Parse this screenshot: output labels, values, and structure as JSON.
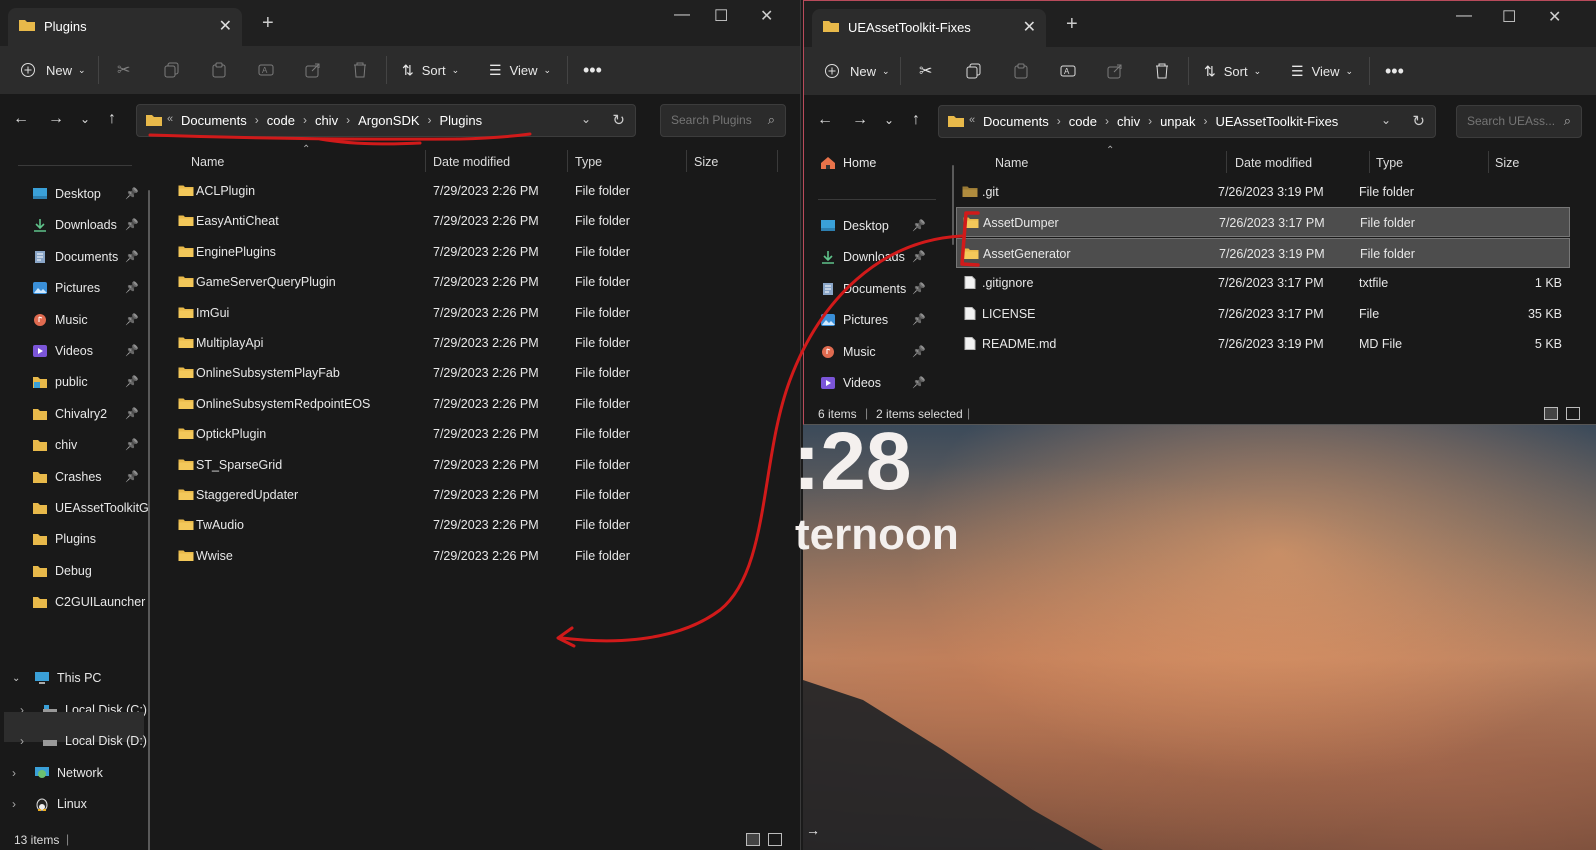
{
  "left_window": {
    "tab_title": "Plugins",
    "toolbar": {
      "new_label": "New",
      "sort_label": "Sort",
      "view_label": "View"
    },
    "breadcrumb": [
      "Documents",
      "code",
      "chiv",
      "ArgonSDK",
      "Plugins"
    ],
    "search_placeholder": "Search Plugins",
    "sidebar": [
      {
        "label": "Desktop",
        "pinned": true
      },
      {
        "label": "Downloads",
        "pinned": true
      },
      {
        "label": "Documents",
        "pinned": true
      },
      {
        "label": "Pictures",
        "pinned": true
      },
      {
        "label": "Music",
        "pinned": true
      },
      {
        "label": "Videos",
        "pinned": true
      },
      {
        "label": "public",
        "pinned": true
      },
      {
        "label": "Chivalry2",
        "pinned": true
      },
      {
        "label": "chiv",
        "pinned": true
      },
      {
        "label": "Crashes",
        "pinned": true
      },
      {
        "label": "UEAssetToolkitG",
        "pinned": false
      },
      {
        "label": "Plugins",
        "pinned": false
      },
      {
        "label": "Debug",
        "pinned": false
      },
      {
        "label": "C2GUILauncher",
        "pinned": false
      }
    ],
    "tree": [
      "This PC",
      "Local Disk (C:)",
      "Local Disk (D:)",
      "Network",
      "Linux"
    ],
    "columns": {
      "name": "Name",
      "date": "Date modified",
      "type": "Type",
      "size": "Size"
    },
    "files": [
      {
        "name": "ACLPlugin",
        "date": "7/29/2023 2:26 PM",
        "type": "File folder"
      },
      {
        "name": "EasyAntiCheat",
        "date": "7/29/2023 2:26 PM",
        "type": "File folder"
      },
      {
        "name": "EnginePlugins",
        "date": "7/29/2023 2:26 PM",
        "type": "File folder"
      },
      {
        "name": "GameServerQueryPlugin",
        "date": "7/29/2023 2:26 PM",
        "type": "File folder"
      },
      {
        "name": "ImGui",
        "date": "7/29/2023 2:26 PM",
        "type": "File folder"
      },
      {
        "name": "MultiplayApi",
        "date": "7/29/2023 2:26 PM",
        "type": "File folder"
      },
      {
        "name": "OnlineSubsystemPlayFab",
        "date": "7/29/2023 2:26 PM",
        "type": "File folder"
      },
      {
        "name": "OnlineSubsystemRedpointEOS",
        "date": "7/29/2023 2:26 PM",
        "type": "File folder"
      },
      {
        "name": "OptickPlugin",
        "date": "7/29/2023 2:26 PM",
        "type": "File folder"
      },
      {
        "name": "ST_SparseGrid",
        "date": "7/29/2023 2:26 PM",
        "type": "File folder"
      },
      {
        "name": "StaggeredUpdater",
        "date": "7/29/2023 2:26 PM",
        "type": "File folder"
      },
      {
        "name": "TwAudio",
        "date": "7/29/2023 2:26 PM",
        "type": "File folder"
      },
      {
        "name": "Wwise",
        "date": "7/29/2023 2:26 PM",
        "type": "File folder"
      }
    ],
    "status": "13 items"
  },
  "right_window": {
    "tab_title": "UEAssetToolkit-Fixes",
    "toolbar": {
      "new_label": "New",
      "sort_label": "Sort",
      "view_label": "View"
    },
    "breadcrumb": [
      "Documents",
      "code",
      "chiv",
      "unpak",
      "UEAssetToolkit-Fixes"
    ],
    "search_placeholder": "Search UEAss...",
    "sidebar": [
      {
        "label": "Home",
        "pinned": false
      },
      {
        "label": "Desktop",
        "pinned": true
      },
      {
        "label": "Downloads",
        "pinned": true
      },
      {
        "label": "Documents",
        "pinned": true
      },
      {
        "label": "Pictures",
        "pinned": true
      },
      {
        "label": "Music",
        "pinned": true
      },
      {
        "label": "Videos",
        "pinned": true
      }
    ],
    "columns": {
      "name": "Name",
      "date": "Date modified",
      "type": "Type",
      "size": "Size"
    },
    "files": [
      {
        "name": ".git",
        "date": "7/26/2023 3:19 PM",
        "type": "File folder",
        "size": "",
        "kind": "folder-dim",
        "selected": false
      },
      {
        "name": "AssetDumper",
        "date": "7/26/2023 3:17 PM",
        "type": "File folder",
        "size": "",
        "kind": "folder",
        "selected": true
      },
      {
        "name": "AssetGenerator",
        "date": "7/26/2023 3:19 PM",
        "type": "File folder",
        "size": "",
        "kind": "folder",
        "selected": true
      },
      {
        "name": ".gitignore",
        "date": "7/26/2023 3:17 PM",
        "type": "txtfile",
        "size": "1 KB",
        "kind": "file",
        "selected": false
      },
      {
        "name": "LICENSE",
        "date": "7/26/2023 3:17 PM",
        "type": "File",
        "size": "35 KB",
        "kind": "file",
        "selected": false
      },
      {
        "name": "README.md",
        "date": "7/26/2023 3:19 PM",
        "type": "MD File",
        "size": "5 KB",
        "kind": "file",
        "selected": false
      }
    ],
    "status_items": "6 items",
    "status_selected": "2 items selected"
  },
  "desktop": {
    "clock": ":28",
    "greeting": "ternoon"
  },
  "colors": {
    "folder": "#e8b94a",
    "annotation": "#d11a1a",
    "selection": "#4d4d4d"
  }
}
